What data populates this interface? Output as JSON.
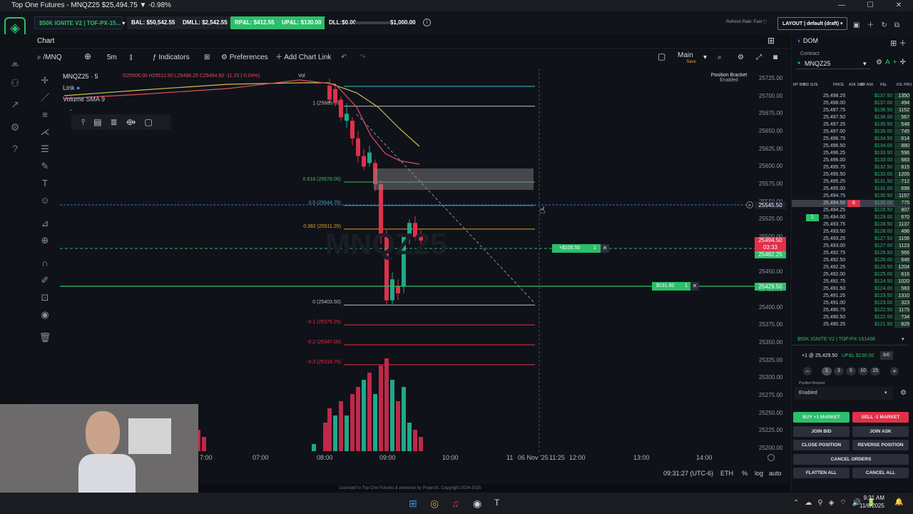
{
  "window": {
    "title": "Top One Futures - MNQZ25 $25,494.75 ▼ -0.98%"
  },
  "topbar": {
    "account": "$50K IGNITE V2 | TOF-PX-15...",
    "bal": "BAL: $50,542.55",
    "dmll": "DMLL: $2,542.55",
    "rpl": "RP&L: $412.55",
    "upl": "UP&L: $130.00",
    "dll": "DLL:$0.00",
    "dll_limit": "$1,000.00",
    "refresh": "Refresh Rate: Fast",
    "layout": "LAYOUT | default (draft)"
  },
  "chart": {
    "tab": "Chart",
    "symbol": "/MNQ",
    "interval": "5m",
    "indicators": "Indicators",
    "preferences": "Preferences",
    "add_link": "Add Chart Link",
    "template": "Main",
    "template_sub": "Save",
    "legend_symbol": "MNQZ25 · 5",
    "legend_ohlc": "O25506.00 H25512.50 L25488.25 C25494.50 -11.25 (-0.04%)",
    "legend_vol": "Vol",
    "legend_link": "Link",
    "legend_volume": "Volume SMA 9",
    "watermark": "MNQZ25",
    "position_bracket": "Position Bracket",
    "position_bracket_state": "Enabled",
    "fib": [
      {
        "label": "1 (25685.75)",
        "price": 25685.75,
        "color": "#bfbfbf"
      },
      {
        "label": "0.618 (25578.00)",
        "price": 25578.0,
        "color": "#3fbf6a"
      },
      {
        "label": "0.5 (25544.75)",
        "price": 25544.75,
        "color": "#3aa6c4"
      },
      {
        "label": "0.382 (25511.25)",
        "price": 25511.25,
        "color": "#e0a030"
      },
      {
        "label": "0 (25403.50)",
        "price": 25403.5,
        "color": "#bfbfbf"
      },
      {
        "label": "-0.1 (25375.25)",
        "price": 25375.25,
        "color": "#e0304a"
      },
      {
        "label": "-0.2 (25347.00)",
        "price": 25347.0,
        "color": "#e0304a"
      },
      {
        "label": "-0.3 (25318.75)",
        "price": 25318.75,
        "color": "#e0304a"
      }
    ],
    "price_axis": [
      "25725.00",
      "25700.00",
      "25675.00",
      "25650.00",
      "25625.00",
      "25600.00",
      "25575.00",
      "25550.00",
      "25525.00",
      "25500.00",
      "25475.00",
      "25450.00",
      "25425.00",
      "25400.00",
      "25375.00",
      "25350.00",
      "25325.00",
      "25300.00",
      "25275.00",
      "25250.00",
      "25225.00",
      "25200.00"
    ],
    "crosshair_price": "25545.50",
    "last_price": "25494.50",
    "last_time": "03:33",
    "entry_price": "25482.25",
    "stop_price": "25429.50",
    "order_tp_label": "+$105.50",
    "order_tp_qty": "1",
    "order_stop_label": "$131.50",
    "order_stop_qty": "1",
    "time_axis": [
      "7:00",
      "07:00",
      "08:00",
      "09:00",
      "10:00",
      "11",
      "06 Nov '25",
      "11:25",
      "12:00",
      "13:00",
      "14:00"
    ],
    "clock": "09:31:27 (UTC-6)",
    "session": "ETH",
    "pct": "%",
    "log": "log",
    "auto": "auto",
    "footer": "Licensed to Top One Futures & powered by ProjectX. Copyright 2024-2025"
  },
  "dom": {
    "tab": "DOM",
    "contract_label": "Contract",
    "contract": "MNQZ25",
    "headers": [
      "MY BID",
      "BID SIZE",
      "PRICE",
      "ASK SIZE",
      "MY ASK",
      "P&L",
      "VOL PRO."
    ],
    "rows": [
      {
        "price": "25,498.25",
        "pnl": "$137.50",
        "vol": "1350"
      },
      {
        "price": "25,498.00",
        "pnl": "$137.00",
        "vol": "494"
      },
      {
        "price": "25,497.75",
        "pnl": "$136.50",
        "vol": "1152"
      },
      {
        "price": "25,497.50",
        "pnl": "$136.00",
        "vol": "567"
      },
      {
        "price": "25,497.25",
        "pnl": "$135.50",
        "vol": "548"
      },
      {
        "price": "25,497.00",
        "pnl": "$135.00",
        "vol": "745"
      },
      {
        "price": "25,496.75",
        "pnl": "$134.50",
        "vol": "614"
      },
      {
        "price": "25,496.50",
        "pnl": "$134.00",
        "vol": "880"
      },
      {
        "price": "25,496.25",
        "pnl": "$133.50",
        "vol": "596"
      },
      {
        "price": "25,496.00",
        "pnl": "$133.00",
        "vol": "683"
      },
      {
        "price": "25,495.75",
        "pnl": "$132.50",
        "vol": "815"
      },
      {
        "price": "25,495.50",
        "pnl": "$132.00",
        "vol": "1205"
      },
      {
        "price": "25,495.25",
        "pnl": "$131.50",
        "vol": "712"
      },
      {
        "price": "25,495.00",
        "pnl": "$131.00",
        "vol": "698"
      },
      {
        "price": "25,494.75",
        "pnl": "$130.50",
        "vol": "1167"
      },
      {
        "price": "25,494.50",
        "pnl": "$130.00",
        "vol": "775",
        "ask": "6",
        "hl": true
      },
      {
        "price": "25,494.25",
        "pnl": "$129.50",
        "vol": "807"
      },
      {
        "price": "25,494.00",
        "pnl": "$129.00",
        "vol": "670",
        "bid": "1"
      },
      {
        "price": "25,493.75",
        "pnl": "$128.50",
        "vol": "1137"
      },
      {
        "price": "25,493.50",
        "pnl": "$128.00",
        "vol": "496"
      },
      {
        "price": "25,493.25",
        "pnl": "$127.50",
        "vol": "1156"
      },
      {
        "price": "25,493.00",
        "pnl": "$127.00",
        "vol": "1123"
      },
      {
        "price": "25,492.75",
        "pnl": "$126.50",
        "vol": "566"
      },
      {
        "price": "25,492.50",
        "pnl": "$126.00",
        "vol": "646"
      },
      {
        "price": "25,492.25",
        "pnl": "$125.50",
        "vol": "1204"
      },
      {
        "price": "25,492.00",
        "pnl": "$125.00",
        "vol": "616"
      },
      {
        "price": "25,491.75",
        "pnl": "$124.50",
        "vol": "1020"
      },
      {
        "price": "25,491.50",
        "pnl": "$124.00",
        "vol": "583"
      },
      {
        "price": "25,491.25",
        "pnl": "$123.50",
        "vol": "1310"
      },
      {
        "price": "25,491.00",
        "pnl": "$123.00",
        "vol": "323"
      },
      {
        "price": "25,490.75",
        "pnl": "$122.50",
        "vol": "1175"
      },
      {
        "price": "25,490.50",
        "pnl": "$122.00",
        "vol": "734"
      },
      {
        "price": "25,490.25",
        "pnl": "$121.50",
        "vol": "829"
      }
    ],
    "account": "$50K IGNITE V2 | TOF-PX-151438",
    "position": "+1 @ 25,429.50",
    "upl": "UP&L $130.00",
    "be": "B/E",
    "qty_options": [
      "1",
      "3",
      "5",
      "10",
      "15"
    ],
    "bracket_label": "Position Bracket",
    "bracket_value": "Enabled",
    "buy": "BUY +1 MARKET",
    "sell": "SELL -1 MARKET",
    "join_bid": "JOIN BID",
    "join_ask": "JOIN ASK",
    "close_pos": "CLOSE POSITION",
    "reverse_pos": "REVERSE POSITION",
    "cancel_orders": "CANCEL ORDERS",
    "flatten": "FLATTEN ALL",
    "cancel_all": "CANCEL ALL"
  },
  "taskbar": {
    "time": "9:31 AM",
    "date": "11/6/2025"
  }
}
